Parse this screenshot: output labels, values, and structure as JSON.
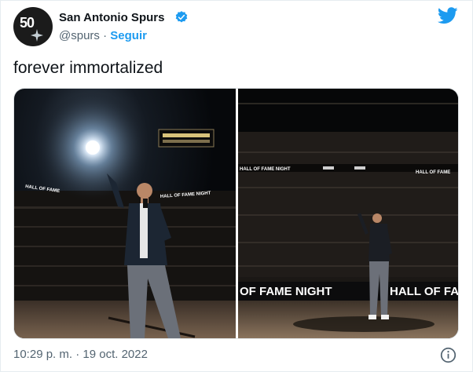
{
  "author": {
    "name": "San Antonio Spurs",
    "handle": "@spurs",
    "separator": " · ",
    "follow_label": "Seguir",
    "avatar_text": "50"
  },
  "tweet": {
    "text": "forever immortalized",
    "timestamp": "10:29 p. m. · 19 oct. 2022"
  },
  "media": {
    "left_photo": {
      "banners": [
        "HALL OF FAME",
        "HALL OF FAME NIGHT"
      ]
    },
    "right_photo": {
      "banners": [
        "OF FAME NIGHT",
        "HALL OF FAME",
        "HALL OF FAME NIGHT"
      ]
    }
  },
  "colors": {
    "accent": "#1d9bf0",
    "text": "#0f1419",
    "muted": "#536471"
  },
  "icons": {
    "verified": "verified-badge-icon",
    "brand": "twitter-bird-icon",
    "info": "info-icon"
  }
}
